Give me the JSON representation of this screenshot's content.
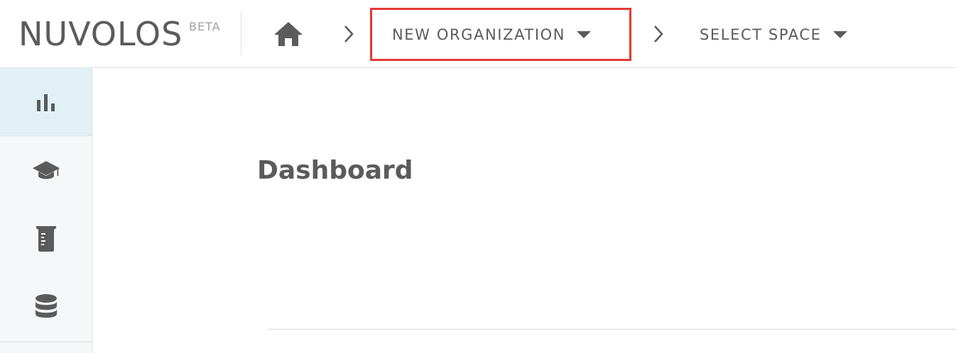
{
  "header": {
    "logo": "NUVOLOS",
    "logo_badge": "BETA",
    "home_icon": "home-icon",
    "breadcrumb": {
      "organization": "NEW ORGANIZATION",
      "space": "SELECT SPACE"
    },
    "highlight_color": "#e53935"
  },
  "sidebar": {
    "items": [
      {
        "icon": "bar-chart-icon",
        "active": true
      },
      {
        "icon": "graduation-cap-icon",
        "active": false
      },
      {
        "icon": "beaker-icon",
        "active": false
      },
      {
        "icon": "database-icon",
        "active": false
      }
    ],
    "active_color": "#e0f0f5"
  },
  "main": {
    "title": "Dashboard"
  }
}
